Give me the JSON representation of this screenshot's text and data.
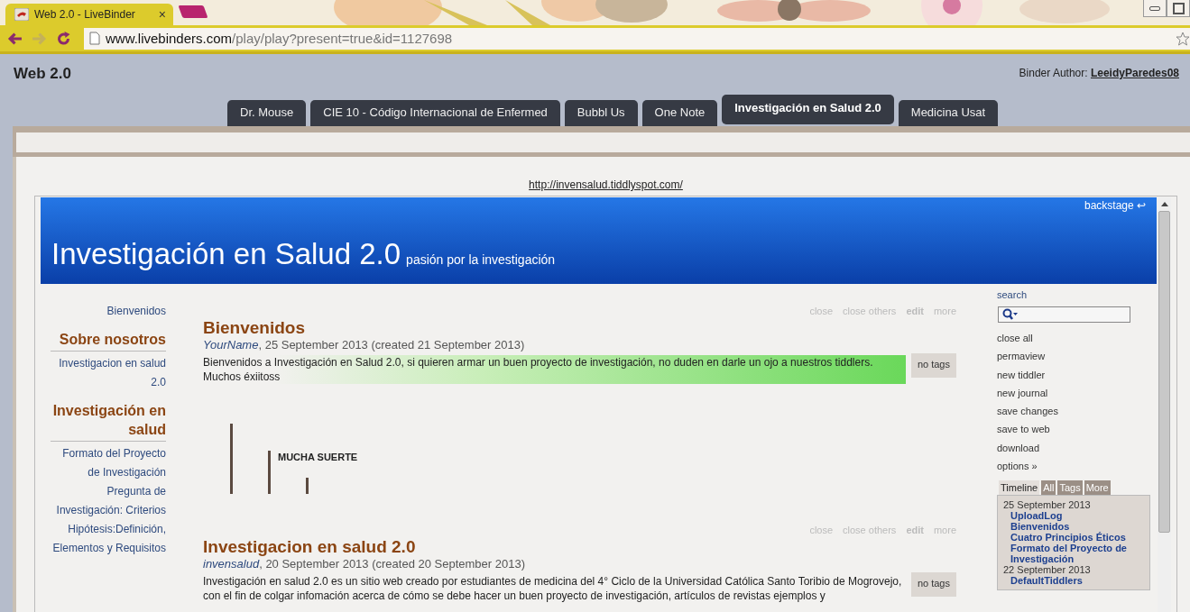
{
  "browser": {
    "tab": {
      "title": "Web 2.0 - LiveBinder",
      "close": "×"
    },
    "address": {
      "host": "www.livebinders.com",
      "path": "/play/play?present=true&id=1127698"
    }
  },
  "binder": {
    "title": "Web 2.0",
    "author_label": "Binder Author:",
    "author": "LeeidyParedes08",
    "tabs": [
      {
        "label": "Dr. Mouse",
        "selected": false
      },
      {
        "label": "CIE 10 - Código Internacional de Enfermed",
        "selected": false
      },
      {
        "label": "Bubbl Us",
        "selected": false
      },
      {
        "label": "One Note",
        "selected": false
      },
      {
        "label": "Investigación en Salud 2.0",
        "selected": true
      },
      {
        "label": "Medicina Usat",
        "selected": false
      }
    ]
  },
  "frame": {
    "url": "http://invensalud.tiddlyspot.com/"
  },
  "wiki": {
    "backstage": "backstage ↩",
    "site_title": "Investigación en Salud 2.0",
    "site_subtitle": "pasión por la investigación",
    "main_menu": [
      {
        "kind": "link",
        "text": "Bienvenidos"
      },
      {
        "kind": "heading",
        "text": "Sobre nosotros"
      },
      {
        "kind": "link",
        "text": "Investigacion en salud 2.0"
      },
      {
        "kind": "heading",
        "text": "Investigación en salud"
      },
      {
        "kind": "link",
        "text": "Formato del Proyecto de Investigación"
      },
      {
        "kind": "link",
        "text": "Pregunta de Investigación: Criterios"
      },
      {
        "kind": "link",
        "text": "Hipótesis:Definición, Elementos y Requisitos"
      }
    ],
    "tiddlers": [
      {
        "toolbar": [
          {
            "label": "close",
            "emphasis": false
          },
          {
            "label": "close others",
            "emphasis": false
          },
          {
            "label": "edit",
            "emphasis": true
          },
          {
            "label": "more",
            "emphasis": false
          }
        ],
        "title": "Bienvenidos",
        "modifier": "YourName",
        "dates": ", 25 September 2013 (created 21 September 2013)",
        "body": "Bienvenidos a Investigación en Salud 2.0, si quieren armar un buen proyecto de investigación, no duden en darle un ojo a nuestros tiddlers. Muchos éxiitoss",
        "highlight": true,
        "tags": "no tags",
        "banner": "MUCHA SUERTE"
      },
      {
        "toolbar": [
          {
            "label": "close",
            "emphasis": false
          },
          {
            "label": "close others",
            "emphasis": false
          },
          {
            "label": "edit",
            "emphasis": true
          },
          {
            "label": "more",
            "emphasis": false
          }
        ],
        "title": "Investigacion en salud 2.0",
        "modifier": "invensalud",
        "dates": ", 20 September 2013 (created 20 September 2013)",
        "body": "Investigación en salud 2.0 es un sitio web creado por estudiantes de medicina del 4° Ciclo de la Universidad Católica Santo Toribio de Mogrovejo, con el fin de colgar infomación acerca de cómo se debe hacer un buen proyecto de investigación, artículos de revistas ejemplos y",
        "highlight": false,
        "tags": "no tags"
      }
    ],
    "sidebar": {
      "search_label": "search",
      "options": [
        "close all",
        "permaview",
        "new tiddler",
        "new journal",
        "save changes",
        "save to web",
        "download",
        "options »"
      ],
      "timeline_tabs": [
        {
          "label": "Timeline",
          "selected": true
        },
        {
          "label": "All",
          "selected": false
        },
        {
          "label": "Tags",
          "selected": false
        },
        {
          "label": "More",
          "selected": false
        }
      ],
      "timeline": [
        {
          "kind": "date",
          "text": "25 September 2013"
        },
        {
          "kind": "link",
          "text": "UploadLog"
        },
        {
          "kind": "link",
          "text": "Bienvenidos"
        },
        {
          "kind": "link",
          "text": "Cuatro Principios Éticos"
        },
        {
          "kind": "link",
          "text": "Formato del Proyecto de Investigación"
        },
        {
          "kind": "date",
          "text": "22 September 2013"
        },
        {
          "kind": "link",
          "text": "DefaultTiddlers"
        }
      ]
    }
  }
}
